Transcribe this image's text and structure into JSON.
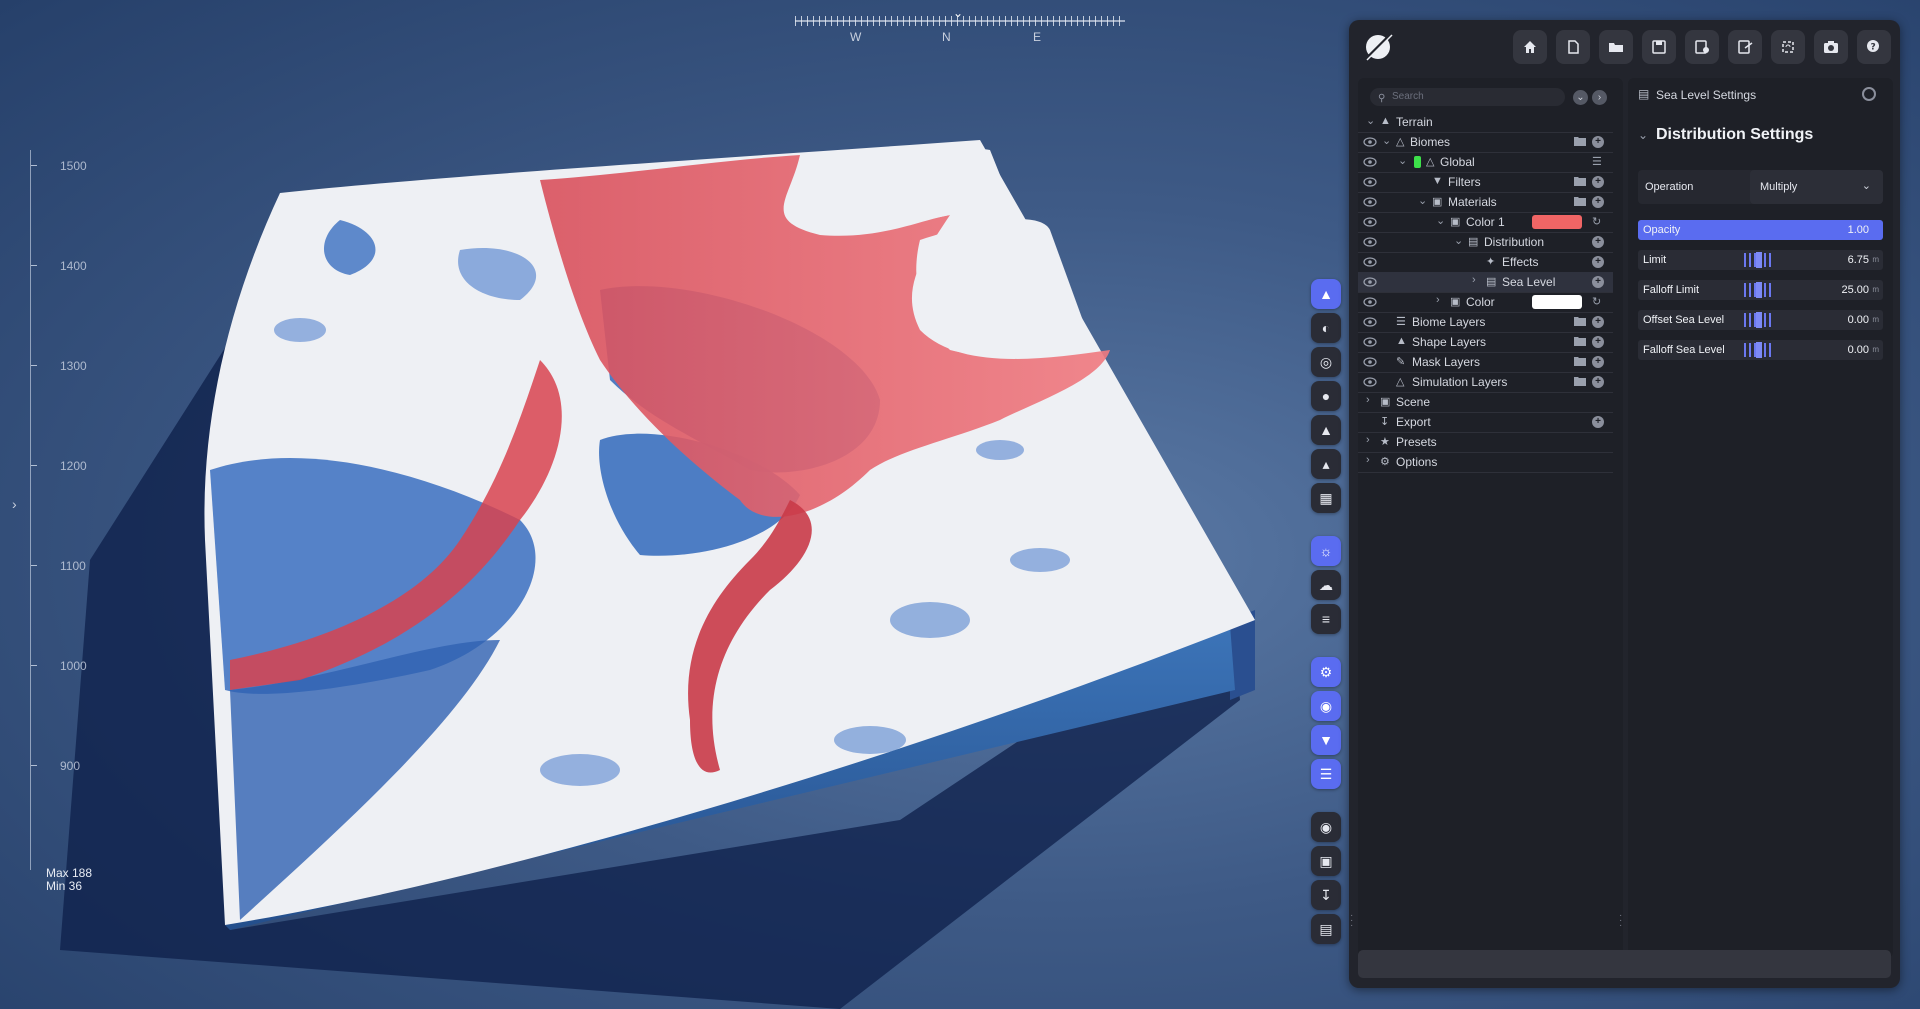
{
  "viewport": {
    "compass": {
      "west": "W",
      "north": "N",
      "east": "E"
    },
    "ruler": {
      "labels": [
        "1500",
        "1400",
        "1300",
        "1200",
        "1100",
        "1000",
        "900"
      ]
    },
    "stats": {
      "max": "Max 188",
      "min": "Min 36"
    }
  },
  "vertical_toolbar": {
    "groups": [
      [
        "terrain-icon",
        "globe-icon",
        "target-icon",
        "water-drop-icon",
        "mountain-icon",
        "landscape-icon",
        "grid-icon"
      ],
      [
        "sun-icon",
        "cloud-icon",
        "fog-icon"
      ],
      [
        "settings-icon",
        "eye-icon",
        "filter-icon",
        "layers-icon"
      ],
      [
        "record-icon",
        "image-icon",
        "download-icon",
        "chart-icon"
      ]
    ]
  },
  "toolbar": {
    "buttons": [
      "home-icon",
      "new-file-icon",
      "open-folder-icon",
      "save-icon",
      "save-as-icon",
      "export-icon",
      "refresh-icon",
      "camera-icon",
      "help-icon"
    ]
  },
  "tree": {
    "search_placeholder": "Search",
    "rows": [
      {
        "label": "Terrain"
      },
      {
        "label": "Biomes"
      },
      {
        "label": "Global"
      },
      {
        "label": "Filters"
      },
      {
        "label": "Materials"
      },
      {
        "label": "Color 1",
        "swatch": "#f06565"
      },
      {
        "label": "Distribution"
      },
      {
        "label": "Effects"
      },
      {
        "label": "Sea Level"
      },
      {
        "label": "Color",
        "swatch": "#ffffff"
      },
      {
        "label": "Biome Layers"
      },
      {
        "label": "Shape Layers"
      },
      {
        "label": "Mask Layers"
      },
      {
        "label": "Simulation Layers"
      },
      {
        "label": "Scene"
      },
      {
        "label": "Export"
      },
      {
        "label": "Presets"
      },
      {
        "label": "Options"
      }
    ]
  },
  "settings": {
    "panel_title": "Sea Level Settings",
    "section_title": "Distribution Settings",
    "operation": {
      "label": "Operation",
      "value": "Multiply"
    },
    "sliders": [
      {
        "label": "Opacity",
        "value": "1.00",
        "unit": "",
        "fill": 1.0
      },
      {
        "label": "Limit",
        "value": "6.75",
        "unit": "m",
        "fill": 0
      },
      {
        "label": "Falloff Limit",
        "value": "25.00",
        "unit": "m",
        "fill": 0
      },
      {
        "label": "Offset Sea Level",
        "value": "0.00",
        "unit": "m",
        "fill": 0
      },
      {
        "label": "Falloff Sea Level",
        "value": "0.00",
        "unit": "m",
        "fill": 0
      }
    ]
  },
  "colors": {
    "accent": "#5a6cf0",
    "panel": "#22242c",
    "green": "#3de04a"
  }
}
